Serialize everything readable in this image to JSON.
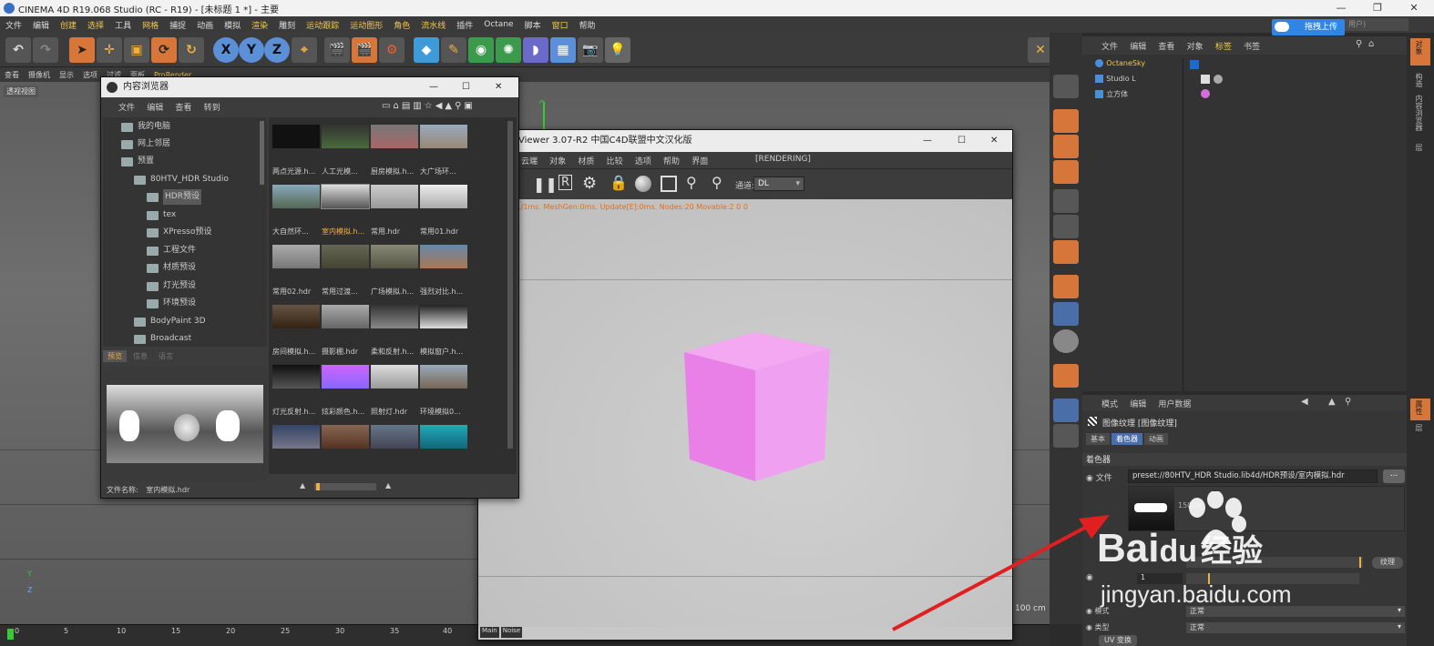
{
  "app": {
    "title": "CINEMA 4D R19.068 Studio (RC - R19) - [未标题 1 *] - 主要",
    "window_controls": [
      "—",
      "❐",
      "✕"
    ]
  },
  "menubar": {
    "items": [
      "文件",
      "编辑",
      "创建",
      "选择",
      "工具",
      "网格",
      "捕捉",
      "动画",
      "模拟",
      "渲染",
      "雕刻",
      "运动跟踪",
      "运动图形",
      "角色",
      "流水线",
      "插件",
      "Octane",
      "脚本",
      "窗口",
      "帮助"
    ],
    "upload_label": "拖拽上传",
    "user_label": "用户)"
  },
  "viewport": {
    "menu": [
      "查看",
      "摄像机",
      "显示",
      "选项",
      "过滤",
      "面板",
      "ProRender"
    ],
    "label": "透视视图",
    "scale": "100 cm",
    "axis_y": "Y",
    "axis_z": "Z"
  },
  "timeline": {
    "frame_start": "0",
    "ticks": [
      "5",
      "10",
      "15",
      "20",
      "25",
      "30",
      "35",
      "40"
    ]
  },
  "content_browser": {
    "title": "内容浏览器",
    "menu": [
      "文件",
      "编辑",
      "查看",
      "转到"
    ],
    "tree": [
      {
        "label": "我的电脑",
        "level": 0
      },
      {
        "label": "网上邻居",
        "level": 0
      },
      {
        "label": "预置",
        "level": 0
      },
      {
        "label": "80HTV_HDR Studio",
        "level": 1
      },
      {
        "label": "HDR预设",
        "level": 2
      },
      {
        "label": "tex",
        "level": 2
      },
      {
        "label": "XPresso预设",
        "level": 2
      },
      {
        "label": "工程文件",
        "level": 2
      },
      {
        "label": "材质预设",
        "level": 2
      },
      {
        "label": "灯光预设",
        "level": 2
      },
      {
        "label": "环境预设",
        "level": 2
      },
      {
        "label": "BodyPaint 3D",
        "level": 1
      },
      {
        "label": "Broadcast",
        "level": 1
      }
    ],
    "preview_tabs": [
      "预览",
      "信息",
      "语言"
    ],
    "filename_label": "文件名称:",
    "filename": "室内模拟.hdr",
    "thumbnails": [
      "两点光源.h...",
      "人工光模...",
      "厨房模拟.h...",
      "大广场环...",
      "大自然环...",
      "室内模拟.h...",
      "常用.hdr",
      "常用01.hdr",
      "常用02.hdr",
      "常用过渡...",
      "广场模拟.h...",
      "强烈对比.h...",
      "房间模拟.h...",
      "摄影棚.hdr",
      "柔和反射.h...",
      "模拟窗户.h...",
      "灯光反射.h...",
      "炫彩颜色.h...",
      "照射灯.hdr",
      "环境模拟0..."
    ]
  },
  "live_viewer": {
    "title": "Viewer 3.07-R2 中国C4D联盟中文汉化版",
    "menu": [
      "云端",
      "对象",
      "材质",
      "比较",
      "选项",
      "帮助",
      "界面"
    ],
    "status_right": "[RENDERING]",
    "channel_label": "通道:",
    "channel_value": "DL",
    "stats": "s./1ms. MeshGen:0ms. Update[E]:0ms. Nodes:20 Movable:2  0 0",
    "bottom_tabs": [
      "Main",
      "Noise"
    ]
  },
  "object_manager": {
    "menu": [
      "文件",
      "编辑",
      "查看",
      "对象",
      "标签",
      "书签"
    ],
    "objects": [
      {
        "name": "OctaneSky",
        "color": "#f0c850"
      },
      {
        "name": "Studio L",
        "color": "#dddddd"
      },
      {
        "name": "立方体",
        "color": "#dddddd"
      }
    ]
  },
  "attributes": {
    "menu": [
      "模式",
      "编辑",
      "用户数据"
    ],
    "title": "图像纹理 [图像纹理]",
    "tabs": [
      "基本",
      "着色器",
      "动画"
    ],
    "section": "着色器",
    "file_label": "文件",
    "file_path": "preset://80HTV_HDR Studio.lib4d/HDR预设/室内模拟.hdr",
    "browse_label": "...",
    "resolution_hint": "1500×",
    "texture_button": "纹理",
    "row_value": "1",
    "mode_label": "模式",
    "mode_value": "正常",
    "type_label": "类型",
    "type_value": "正常",
    "uv_label": "UV 变换"
  },
  "far_right_tabs": [
    "对象",
    "构造",
    "内容浏览器",
    "层",
    "属性",
    "层"
  ],
  "watermark": {
    "brand": "Bai",
    "brand2": "du",
    "brand_cn": "经验",
    "url": "jingyan.baidu.com"
  }
}
